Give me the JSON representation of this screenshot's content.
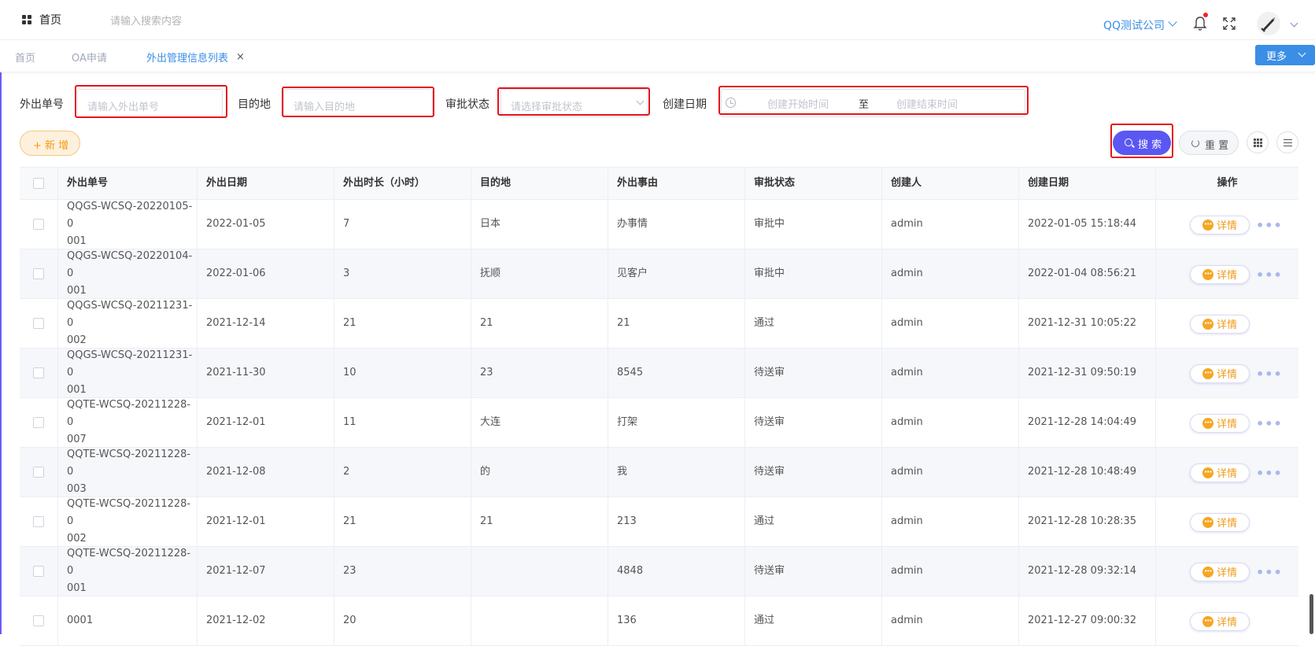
{
  "header": {
    "home_label": "首页",
    "search_placeholder": "请输入搜索内容",
    "company": "QQ测试公司"
  },
  "tabs": [
    {
      "label": "首页"
    },
    {
      "label": "OA申请"
    },
    {
      "label": "外出管理信息列表"
    }
  ],
  "tab_close": "×",
  "more_label": "更多",
  "filters": {
    "no_label": "外出单号",
    "no_placeholder": "请输入外出单号",
    "dest_label": "目的地",
    "dest_placeholder": "请输入目的地",
    "status_label": "审批状态",
    "status_placeholder": "请选择审批状态",
    "date_label": "创建日期",
    "date_start": "创建开始时间",
    "date_sep": "至",
    "date_end": "创建结束时间"
  },
  "actions": {
    "add": "+ 新 增",
    "search": "搜 索",
    "reset": "重 置"
  },
  "table": {
    "columns": [
      "外出单号",
      "外出日期",
      "外出时长（小时）",
      "目的地",
      "外出事由",
      "审批状态",
      "创建人",
      "创建日期",
      "操作"
    ],
    "detail_label": "详情",
    "more_label": "•••",
    "rows": [
      {
        "no_line1": "QQGS-WCSQ-20220105-0",
        "no_line2": "001",
        "date": "2022-01-05",
        "hours": "7",
        "dest": "日本",
        "reason": "办事情",
        "status": "审批中",
        "creator": "admin",
        "created": "2022-01-05 15:18:44",
        "has_more": true
      },
      {
        "no_line1": "QQGS-WCSQ-20220104-0",
        "no_line2": "001",
        "date": "2022-01-06",
        "hours": "3",
        "dest": "抚顺",
        "reason": "见客户",
        "status": "审批中",
        "creator": "admin",
        "created": "2022-01-04 08:56:21",
        "has_more": true
      },
      {
        "no_line1": "QQGS-WCSQ-20211231-0",
        "no_line2": "002",
        "date": "2021-12-14",
        "hours": "21",
        "dest": "21",
        "reason": "21",
        "status": "通过",
        "creator": "admin",
        "created": "2021-12-31 10:05:22",
        "has_more": false
      },
      {
        "no_line1": "QQGS-WCSQ-20211231-0",
        "no_line2": "001",
        "date": "2021-11-30",
        "hours": "10",
        "dest": "23",
        "reason": "8545",
        "status": "待送审",
        "creator": "admin",
        "created": "2021-12-31 09:50:19",
        "has_more": true
      },
      {
        "no_line1": "QQTE-WCSQ-20211228-0",
        "no_line2": "007",
        "date": "2021-12-01",
        "hours": "11",
        "dest": "大连",
        "reason": "打架",
        "status": "待送审",
        "creator": "admin",
        "created": "2021-12-28 14:04:49",
        "has_more": true
      },
      {
        "no_line1": "QQTE-WCSQ-20211228-0",
        "no_line2": "003",
        "date": "2021-12-08",
        "hours": "2",
        "dest": "的",
        "reason": "我",
        "status": "待送审",
        "creator": "admin",
        "created": "2021-12-28 10:48:49",
        "has_more": true
      },
      {
        "no_line1": "QQTE-WCSQ-20211228-0",
        "no_line2": "002",
        "date": "2021-12-01",
        "hours": "21",
        "dest": "21",
        "reason": "213",
        "status": "通过",
        "creator": "admin",
        "created": "2021-12-28 10:28:35",
        "has_more": false
      },
      {
        "no_line1": "QQTE-WCSQ-20211228-0",
        "no_line2": "001",
        "date": "2021-12-07",
        "hours": "23",
        "dest": "",
        "reason": "4848",
        "status": "待送审",
        "creator": "admin",
        "created": "2021-12-28 09:32:14",
        "has_more": true
      },
      {
        "no_line1": "0001",
        "no_line2": "",
        "date": "2021-12-02",
        "hours": "20",
        "dest": "",
        "reason": "136",
        "status": "通过",
        "creator": "admin",
        "created": "2021-12-27 09:00:32",
        "has_more": false
      }
    ]
  }
}
